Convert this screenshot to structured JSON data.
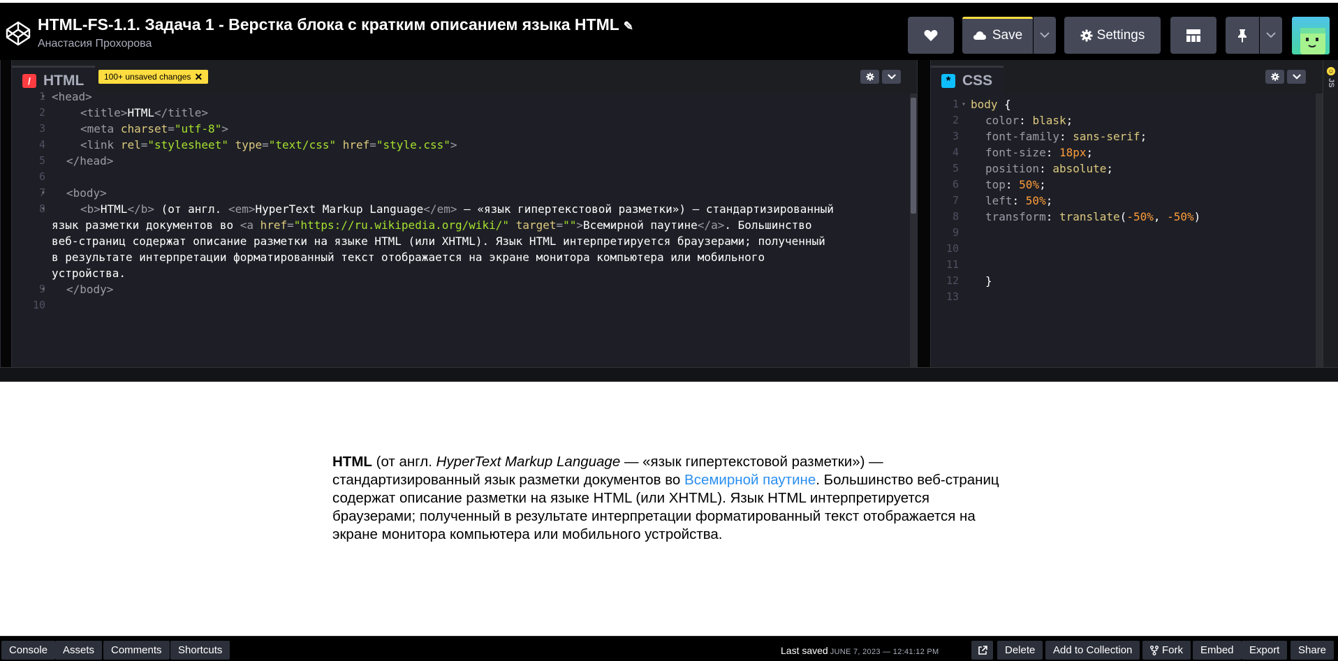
{
  "header": {
    "title": "HTML-FS-1.1. Задача 1 - Верстка блока с кратким описанием языка HTML",
    "pencil": "✎",
    "author": "Анастасия Прохорова",
    "save_label": "Save",
    "settings_label": "Settings"
  },
  "html_panel": {
    "label": "HTML",
    "icon": "/",
    "unsaved_badge": "100+ unsaved changes",
    "unsaved_close": "✕",
    "lines": [
      {
        "n": "1",
        "fold": true
      },
      {
        "n": "2"
      },
      {
        "n": "3"
      },
      {
        "n": "4"
      },
      {
        "n": "5"
      },
      {
        "n": "6"
      },
      {
        "n": "7",
        "fold": true
      },
      {
        "n": "8",
        "fold": true
      },
      {
        "n": "9",
        "fold": true
      },
      {
        "n": "10"
      }
    ],
    "code": {
      "l1": "<head>",
      "l2_open": "<title>",
      "l2_text": "HTML",
      "l2_close": "</title>",
      "l3_tag": "<meta",
      "l3_attr": "charset",
      "l3_eq": "=",
      "l3_val": "\"utf-8\"",
      "l3_end": ">",
      "l4_tag": "<link",
      "l4_a1": "rel",
      "l4_v1": "\"stylesheet\"",
      "l4_a2": "type",
      "l4_v2": "\"text/css\"",
      "l4_a3": "href",
      "l4_v3": "\"style.css\"",
      "l4_end": ">",
      "l5": "</head>",
      "l7": "<body>",
      "l8a_b": "<b>",
      "l8a_text1": "HTML",
      "l8a_bc": "</b>",
      "l8a_text2": " (от англ. ",
      "l8a_em": "<em>",
      "l8a_text3": "HyperText Markup Language",
      "l8a_emc": "</em>",
      "l8a_text4": " — «язык гипертекстовой разметки») — стандартизированный",
      "l8b_text1": "язык разметки документов во ",
      "l8b_a": "<a",
      "l8b_href": "href",
      "l8b_hv": "\"https://ru.wikipedia.org/wiki/\"",
      "l8b_target": "target",
      "l8b_tv": "\"\"",
      "l8b_gt": ">",
      "l8b_text2": "Всемирной паутине",
      "l8b_ac": "</a>",
      "l8b_text3": ". Большинство",
      "l8c": "веб-страниц содержат описание разметки на языке HTML (или XHTML). Язык HTML интерпретируется браузерами; полученный",
      "l8d": "в результате интерпретации форматированный текст отображается на экране монитора компьютера или мобильного",
      "l8e": "устройства.",
      "l9": "</body>"
    }
  },
  "css_panel": {
    "label": "CSS",
    "icon": "*",
    "lines": [
      {
        "n": "1",
        "fold": true
      },
      {
        "n": "2"
      },
      {
        "n": "3"
      },
      {
        "n": "4"
      },
      {
        "n": "5"
      },
      {
        "n": "6"
      },
      {
        "n": "7"
      },
      {
        "n": "8"
      },
      {
        "n": "9"
      },
      {
        "n": "10"
      },
      {
        "n": "11"
      },
      {
        "n": "12"
      },
      {
        "n": "13"
      }
    ],
    "code": {
      "sel": "body",
      "open": " {",
      "p2": "color",
      "v2": "blask",
      "p3": "font-family",
      "v3": "sans-serif",
      "p4": "font-size",
      "v4": "18px",
      "p5": "position",
      "v5": "absolute",
      "p6": "top",
      "v6": "50%",
      "p7": "left",
      "v7": "50%",
      "p8": "transform",
      "v8a": "translate",
      "v8b": "-50%",
      "v8c": "-50%",
      "close": "}"
    }
  },
  "js_strip": {
    "label": "JS",
    "badge": "☺"
  },
  "preview": {
    "bold": "HTML",
    "t1": " (от англ. ",
    "em": "HyperText Markup Language",
    "t2": " — «язык гипертекстовой разметки») — стандартизированный язык разметки документов во ",
    "link": "Всемирной паутине",
    "t3": ". Большинство веб-страниц содержат описание разметки на языке HTML (или XHTML). Язык HTML интерпретируется браузерами; полученный в результате интерпретации форматированный текст отображается на экране монитора компьютера или мобильного устройства."
  },
  "footer": {
    "console": "Console",
    "assets": "Assets",
    "comments": "Comments",
    "shortcuts": "Shortcuts",
    "last_saved_label": "Last saved",
    "last_saved_date": "JUNE 7, 2023 — 12:41:12 PM",
    "delete": "Delete",
    "add_to_collection": "Add to Collection",
    "fork": "Fork",
    "embed": "Embed",
    "export": "Export",
    "share": "Share"
  }
}
